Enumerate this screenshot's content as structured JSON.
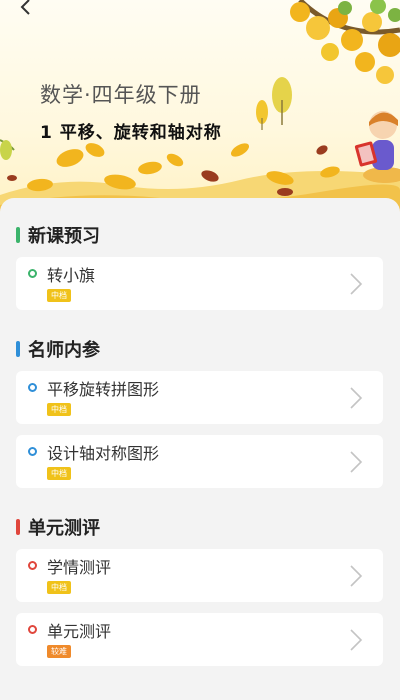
{
  "header": {
    "subject": "数学·四年级下册",
    "lesson": "1 平移、旋转和轴对称"
  },
  "sections": [
    {
      "title": "新课预习",
      "color": "#3bb36b",
      "items": [
        {
          "title": "转小旗",
          "badge": "中档",
          "badge_color": "#f0c21a"
        }
      ]
    },
    {
      "title": "名师内参",
      "color": "#2f8fd8",
      "items": [
        {
          "title": "平移旋转拼图形",
          "badge": "中档",
          "badge_color": "#f0c21a"
        },
        {
          "title": "设计轴对称图形",
          "badge": "中档",
          "badge_color": "#f0c21a"
        }
      ]
    },
    {
      "title": "单元测评",
      "color": "#e0463c",
      "items": [
        {
          "title": "学情测评",
          "badge": "中档",
          "badge_color": "#f0c21a"
        },
        {
          "title": "单元测评",
          "badge": "较难",
          "badge_color": "#ef8a2b"
        }
      ]
    }
  ]
}
